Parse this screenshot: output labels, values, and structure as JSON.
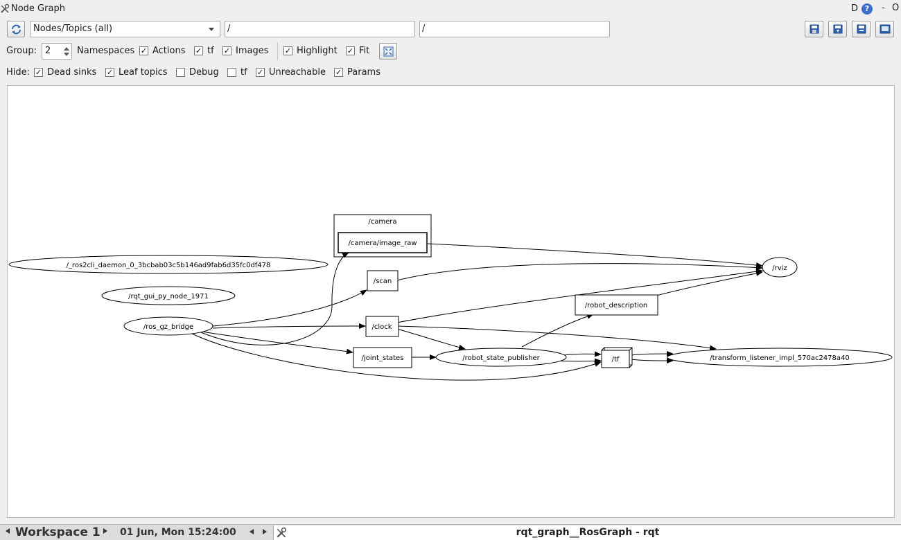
{
  "window": {
    "title": "Node Graph",
    "d_label": "D",
    "help_label": "?",
    "minimize_label": "-",
    "close_label": "O"
  },
  "toolbar": {
    "graph_type_selected": "Nodes/Topics (all)",
    "node_filter_value": "/",
    "topic_filter_value": "/",
    "group_label": "Group:",
    "group_value": "2",
    "namespaces_label": "Namespaces",
    "actions_label": "Actions",
    "tf_label": "tf",
    "images_label": "Images",
    "highlight_label": "Highlight",
    "fit_label": "Fit",
    "actions_checked": true,
    "tf_checked": true,
    "images_checked": true,
    "highlight_checked": true,
    "fit_checked": true
  },
  "hide": {
    "label": "Hide:",
    "dead_sinks_label": "Dead sinks",
    "leaf_topics_label": "Leaf topics",
    "debug_label": "Debug",
    "tf_label": "tf",
    "unreachable_label": "Unreachable",
    "params_label": "Params",
    "dead_sinks_checked": true,
    "leaf_topics_checked": true,
    "debug_checked": false,
    "tf_checked": false,
    "unreachable_checked": true,
    "params_checked": true
  },
  "graph": {
    "namespace_camera": "/camera",
    "topic_camera_image_raw": "/camera/image_raw",
    "node_ros2cli_daemon": "/_ros2cli_daemon_0_3bcbab03c5b146ad9fab6d35fc0df478",
    "node_rqt_gui": "/rqt_gui_py_node_1971",
    "node_ros_gz_bridge": "/ros_gz_bridge",
    "topic_scan": "/scan",
    "topic_clock": "/clock",
    "topic_joint_states": "/joint_states",
    "node_robot_state_publisher": "/robot_state_publisher",
    "topic_tf": "/tf",
    "topic_robot_description": "/robot_description",
    "node_rviz": "/rviz",
    "node_transform_listener": "/transform_listener_impl_570ac2478a40"
  },
  "taskbar": {
    "workspace_label": "Workspace 1",
    "datetime": "01 Jun, Mon 15:24:00",
    "window_title": "rqt_graph__RosGraph - rqt"
  }
}
